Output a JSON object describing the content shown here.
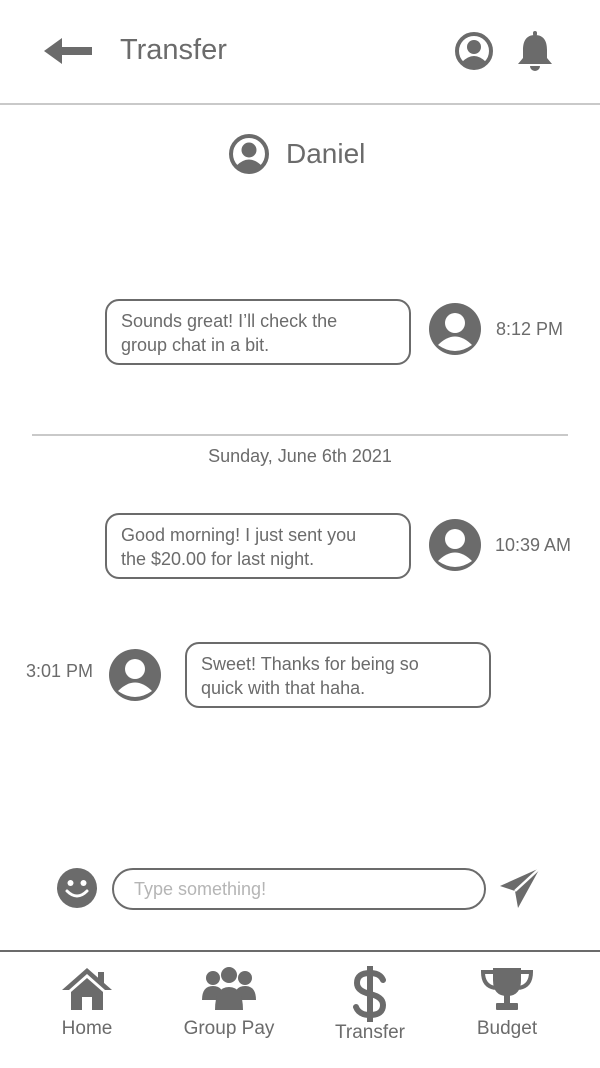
{
  "header": {
    "title": "Transfer",
    "back_icon": "arrow-left-icon",
    "profile_icon": "user-circle-icon",
    "notification_icon": "bell-icon"
  },
  "contact": {
    "name": "Daniel",
    "icon": "user-circle-icon"
  },
  "messages": [
    {
      "text_line1": "Sounds great! I’ll check the",
      "text_line2": "group chat in a bit.",
      "time": "8:12 PM",
      "side": "sent"
    },
    {
      "text_line1": "Good morning! I just sent you",
      "text_line2": "the $20.00 for last night.",
      "time": "10:39 AM",
      "side": "sent"
    },
    {
      "text_line1": "Sweet! Thanks for being so",
      "text_line2": "quick with that haha.",
      "time": "3:01 PM",
      "side": "received"
    }
  ],
  "date_separator": "Sunday, June 6th 2021",
  "composer": {
    "placeholder": "Type something!",
    "emoji_icon": "smiley-icon",
    "send_icon": "paper-plane-icon"
  },
  "nav": [
    {
      "label": "Home",
      "icon": "home-icon"
    },
    {
      "label": "Group Pay",
      "icon": "group-icon"
    },
    {
      "label": "Transfer",
      "icon": "dollar-icon"
    },
    {
      "label": "Budget",
      "icon": "trophy-icon"
    }
  ],
  "colors": {
    "primary": "#6b6b6b",
    "divider": "#c9c9c9",
    "placeholder": "#b5b5b5",
    "background": "#ffffff"
  }
}
